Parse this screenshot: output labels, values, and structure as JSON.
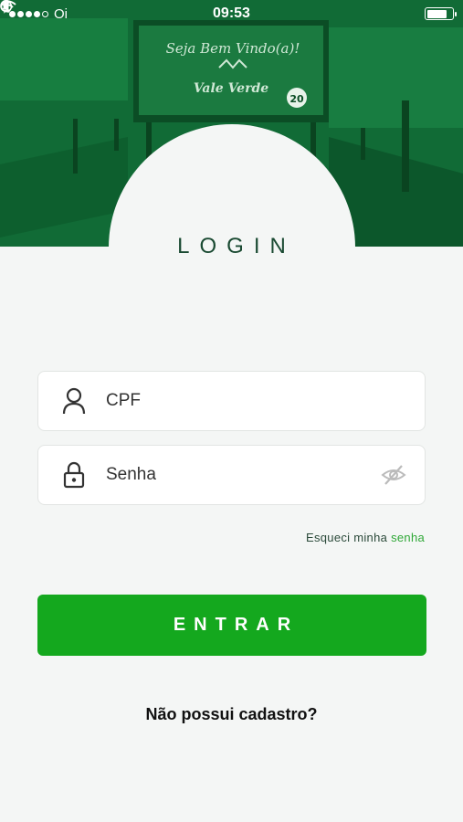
{
  "status_bar": {
    "carrier": "Oi",
    "time": "09:53",
    "signal_bars": 4,
    "icons": [
      "signal-dots",
      "wifi-icon",
      "moon-icon",
      "lock-rotation-icon",
      "location-arrow-icon",
      "bluetooth-icon",
      "battery-icon"
    ],
    "battery_level": 0.8
  },
  "hero": {
    "sign_text": "Seja Bem Vindo(a)!",
    "sign_brand": "Vale Verde",
    "speed_limit": "20"
  },
  "login": {
    "title": "LOGIN",
    "cpf_placeholder": "CPF",
    "password_placeholder": "Senha",
    "forgot_prefix": "Esqueci minha",
    "forgot_link": "senha",
    "submit_label": "ENTRAR",
    "register_label": "Não possui cadastro?"
  },
  "colors": {
    "hero_green": "#0f6a34",
    "button_green": "#14a81e",
    "title_dark_green": "#1a4a32",
    "link_green": "#2fa837",
    "background": "#f4f6f5"
  }
}
